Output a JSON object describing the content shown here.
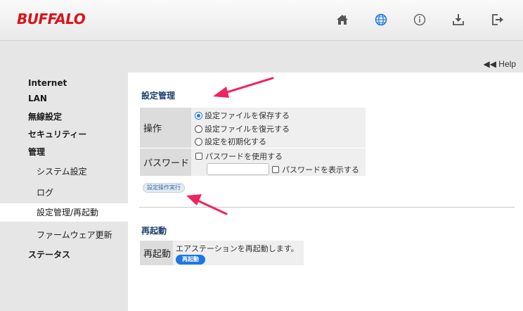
{
  "header": {
    "logo_text": "BUFFALO",
    "icons": [
      "home-icon",
      "globe-icon",
      "info-icon",
      "download-icon",
      "logout-icon"
    ],
    "accent_color": "#1e77e0",
    "brand_color": "#d8141b"
  },
  "help_label": "◀◀ Help",
  "sidebar": {
    "items": [
      {
        "label": "Internet"
      },
      {
        "label": "LAN"
      },
      {
        "label": "無線設定"
      },
      {
        "label": "セキュリティー"
      },
      {
        "label": "管理"
      },
      {
        "label": "システム設定"
      },
      {
        "label": "ログ"
      },
      {
        "label": "設定管理/再起動"
      },
      {
        "label": "ファームウェア更新"
      },
      {
        "label": "ステータス"
      }
    ],
    "active": "設定管理/再起動"
  },
  "config": {
    "title": "設定管理",
    "operation_label": "操作",
    "options": [
      {
        "label": "設定ファイルを保存する",
        "selected": true
      },
      {
        "label": "設定ファイルを復元する",
        "selected": false
      },
      {
        "label": "設定を初期化する",
        "selected": false
      }
    ],
    "password_label": "パスワード",
    "use_password_label": "パスワードを使用する",
    "show_password_label": "パスワードを表示する",
    "password_value": "",
    "execute_button": "設定操作実行"
  },
  "reboot": {
    "title": "再起動",
    "row_label": "再起動",
    "description": "エアステーションを再起動します。",
    "button": "再起動"
  }
}
